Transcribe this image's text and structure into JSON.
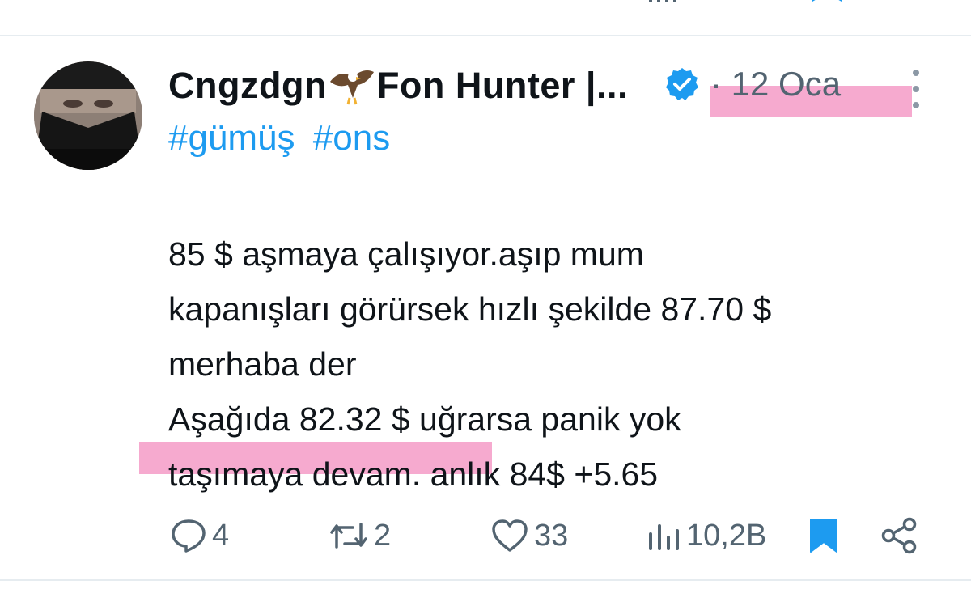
{
  "tweet": {
    "author": {
      "display_name_part1": "Cngzdgn",
      "display_name_part2": "Fon Hunter |...",
      "name_emoji": "eagle-icon",
      "verified": true
    },
    "timestamp": "· 12 Oca",
    "hashtags": [
      "#gümüş",
      "#ons"
    ],
    "body_lines": [
      "85 $ aşmaya çalışıyor.aşıp mum",
      "kapanışları görürsek hızlı şekilde 87.70 $",
      "merhaba der",
      "Aşağıda 82.32 $ uğrarsa panik yok",
      "taşımaya devam. anlık 84$ +5.65"
    ],
    "stats": {
      "replies": "4",
      "retweets": "2",
      "likes": "33",
      "views": "10,2B"
    }
  },
  "colors": {
    "accent": "#1d9bf0",
    "muted": "#536471",
    "highlight": "#f49bc7"
  }
}
